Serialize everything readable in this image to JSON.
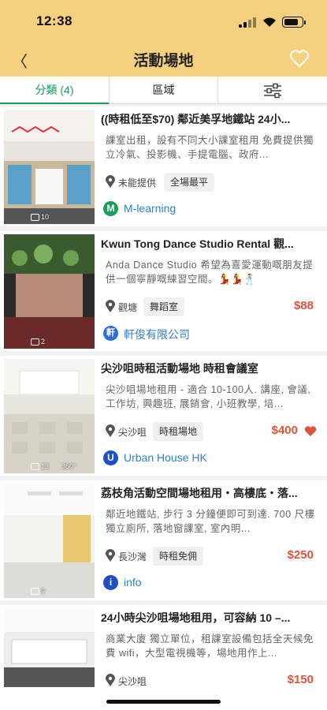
{
  "status_bar": {
    "time": "12:38"
  },
  "nav": {
    "title": "活動場地",
    "back_label": "〈"
  },
  "tabs": [
    {
      "label": "分類 (4)"
    },
    {
      "label": "區域"
    }
  ],
  "colors": {
    "header": "#f5d07f",
    "accent": "#18a05a",
    "price": "#e0533a",
    "link": "#2b7fd4"
  },
  "icons": [
    "back-icon",
    "heart-outline-icon",
    "filter-sliders-icon",
    "pin-icon",
    "camera-icon",
    "heart-filled-icon"
  ],
  "listings": [
    {
      "title": "((時租低至$70) 鄰近美孚地鐵站 24小...",
      "desc": "課室出租，設有不同大小課室租用 免費提供獨立冷氣、投影機、手提電腦、政府...",
      "location": "未能提供",
      "tag": "全場最平",
      "price": "",
      "photo_count": "10",
      "vendor": "M-learning",
      "vendor_initial": "M",
      "vendor_color": "#18a05a"
    },
    {
      "title": "Kwun Tong Dance Studio Rental 觀...",
      "desc": "Anda Dance Studio 希望為喜愛運動嘅朋友提供一個寧靜嘅練習空間。💃💃🕺",
      "location": "觀塘",
      "tag": "舞蹈室",
      "price": "$88",
      "photo_count": "2",
      "vendor": "軒俊有限公司",
      "vendor_initial": "軒",
      "vendor_color": "#2b6fd4"
    },
    {
      "title": "尖沙咀時租活動場地 時租會議室",
      "desc": "尖沙咀場地租用 - 適合 10-100人. 講座, 會議, 工作坊, 興趣班, 展銷會, 小班教學, 培...",
      "location": "尖沙咀",
      "tag": "時租場地",
      "price": "$400",
      "photo_count": "13",
      "photo_extra": "360°",
      "vendor": "Urban House HK",
      "vendor_initial": "U",
      "vendor_color": "#1f4fc2"
    },
    {
      "title": "荔枝角活動空間場地租用・高樓底・落...",
      "desc": "鄰近地鐵站, 步行 3 分鐘便即可到達. 700 尺樓獨立廁所, 落地窗課室, 室內明...",
      "location": "長沙灣",
      "tag": "時租免佣",
      "price": "$250",
      "photo_count": "9",
      "vendor": "info",
      "vendor_initial": "i",
      "vendor_color": "#1f4fc2"
    },
    {
      "title": "24小時尖沙咀場地租用，可容納 10 –...",
      "desc": "商業大廈 獨立單位，租課室設備包括全天候免費 wifi，大型電視機等，場地用作上...",
      "location": "尖沙咀",
      "tag": "",
      "price": "$150",
      "photo_count": "",
      "vendor": "",
      "vendor_initial": "",
      "vendor_color": "#18a05a"
    }
  ]
}
